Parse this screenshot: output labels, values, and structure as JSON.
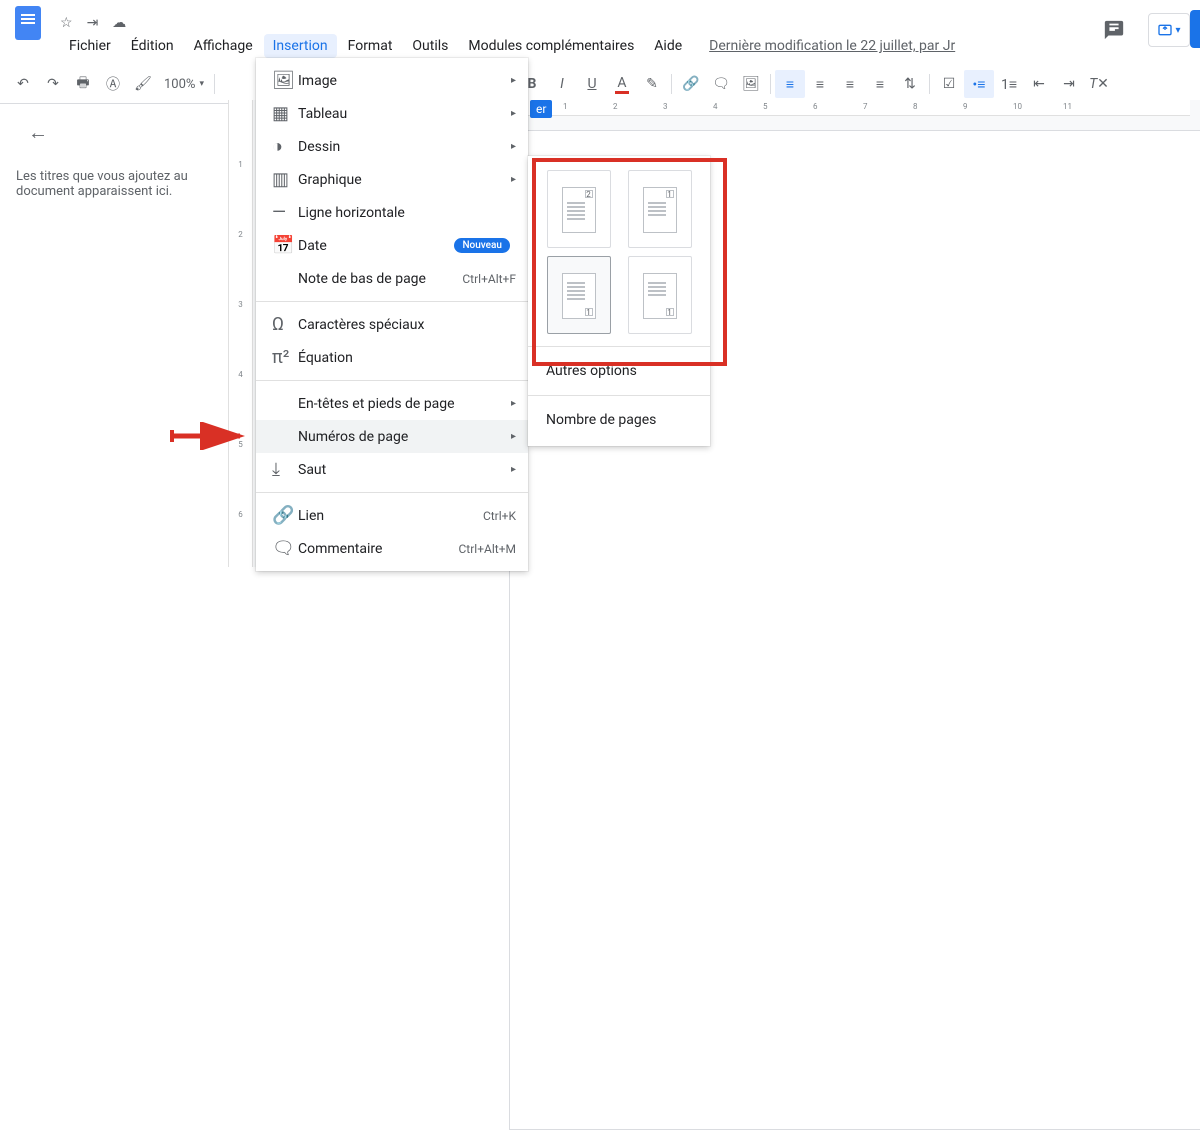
{
  "menubar": {
    "file": "Fichier",
    "edit": "Édition",
    "view": "Affichage",
    "insert": "Insertion",
    "format": "Format",
    "tools": "Outils",
    "addons": "Modules complémentaires",
    "help": "Aide"
  },
  "lastmod": "Dernière modification le 22 juillet, par Jr",
  "zoom": "100%",
  "insert_menu": {
    "image": "Image",
    "table": "Tableau",
    "drawing": "Dessin",
    "chart": "Graphique",
    "hr": "Ligne horizontale",
    "date": "Date",
    "date_badge": "Nouveau",
    "footnote": "Note de bas de page",
    "footnote_sc": "Ctrl+Alt+F",
    "special": "Caractères spéciaux",
    "equation": "Équation",
    "headers": "En-têtes et pieds de page",
    "pagenum": "Numéros de page",
    "break": "Saut",
    "link": "Lien",
    "link_sc": "Ctrl+K",
    "comment": "Commentaire",
    "comment_sc": "Ctrl+Alt+M"
  },
  "submenu": {
    "more": "Autres options",
    "count": "Nombre de pages"
  },
  "outline": {
    "text": "Les titres que vous ajoutez au document apparaissent ici."
  },
  "bluelabel": "er"
}
